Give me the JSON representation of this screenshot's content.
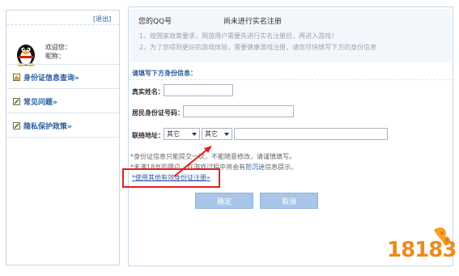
{
  "sidebar": {
    "logout": "[退出]",
    "welcome_line": "欢迎您：",
    "nickname_label": "昵称：",
    "items": [
      {
        "label": "身份证信息查询»",
        "icon": "house-icon"
      },
      {
        "label": "常见问题»",
        "icon": "pencil-icon"
      },
      {
        "label": "隐私保护政策»",
        "icon": "pencil-icon"
      }
    ]
  },
  "notice": {
    "title_prefix": "您的QQ号",
    "title_suffix": "尚未进行实名注册",
    "line1": "1、按国家政策要求，网游用户需要先进行实名注册后，再进入游戏！",
    "line2": "2、为了您得到更好的游戏体验，需要健康游戏注册，请您尽快填写下方的身份信息"
  },
  "form": {
    "heading": "请填写下方身份信息：",
    "name_label": "真实姓名：",
    "id_label": "居民身份证号码：",
    "address_label": "联络地址：",
    "select1_value": "其它",
    "select2_value": "其它"
  },
  "hints": {
    "line1": "*身份证信息只能提交一次，不能随意修改，请谨慎填写。",
    "line2_prefix": "*未满18岁的用户，在游戏过程中将会有",
    "line2_link": "防沉迷",
    "line2_suffix": "信息提示。",
    "link": "*使用其他有效身份证注册»"
  },
  "buttons": {
    "confirm": "确定",
    "cancel": "取消"
  },
  "watermark": {
    "text": "18183"
  },
  "colors": {
    "accent": "#2b5d9e",
    "highlight": "#e02020",
    "button": "#a9c6e8",
    "watermark": "#f08a1c"
  }
}
